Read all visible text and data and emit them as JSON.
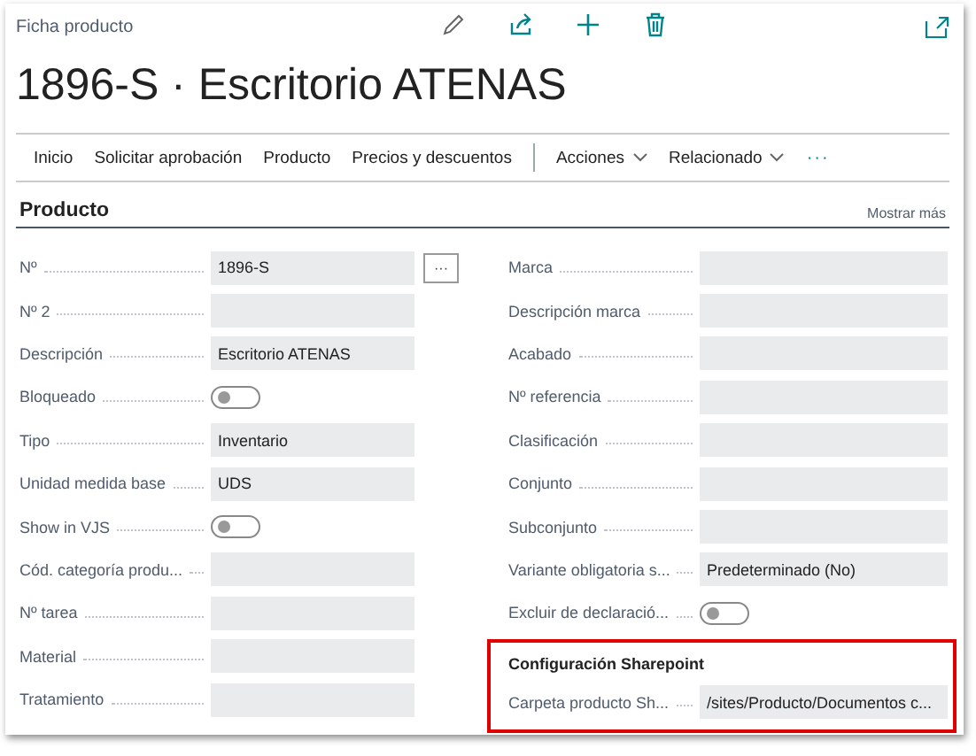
{
  "header": {
    "caption": "Ficha producto",
    "title": "1896-S · Escritorio ATENAS"
  },
  "actions": [
    {
      "label": "Inicio",
      "kind": "plain"
    },
    {
      "label": "Solicitar aprobación",
      "kind": "plain"
    },
    {
      "label": "Producto",
      "kind": "plain"
    },
    {
      "label": "Precios y descuentos",
      "kind": "plain"
    },
    {
      "label": "Acciones",
      "kind": "menu"
    },
    {
      "label": "Relacionado",
      "kind": "menu"
    },
    {
      "label": "···",
      "kind": "more"
    }
  ],
  "section": {
    "title": "Producto",
    "link": "Mostrar más"
  },
  "left_fields": [
    {
      "label": "Nº",
      "kind": "text",
      "value": "1896-S",
      "lookup_button": "···"
    },
    {
      "label": "Nº 2",
      "kind": "text"
    },
    {
      "label": "Descripción",
      "kind": "text",
      "value": "Escritorio ATENAS"
    },
    {
      "label": "Bloqueado",
      "kind": "toggle",
      "on": false
    },
    {
      "label": "Tipo",
      "kind": "text",
      "value": "Inventario"
    },
    {
      "label": "Unidad medida base",
      "kind": "text",
      "value": "UDS"
    },
    {
      "label": "Show in VJS",
      "kind": "toggle",
      "on": false
    },
    {
      "label": "Cód. categoría produ...",
      "kind": "text"
    },
    {
      "label": "Nº tarea",
      "kind": "text"
    },
    {
      "label": "Material",
      "kind": "text"
    },
    {
      "label": "Tratamiento",
      "kind": "text"
    }
  ],
  "right_fields": [
    {
      "label": "Marca",
      "kind": "text"
    },
    {
      "label": "Descripción marca",
      "kind": "text"
    },
    {
      "label": "Acabado",
      "kind": "text"
    },
    {
      "label": "Nº referencia",
      "kind": "text"
    },
    {
      "label": "Clasificación",
      "kind": "text"
    },
    {
      "label": "Conjunto",
      "kind": "text"
    },
    {
      "label": "Subconjunto",
      "kind": "text"
    },
    {
      "label": "Variante obligatoria s...",
      "kind": "text",
      "value": "Predeterminado (No)"
    },
    {
      "label": "Excluir de declaració...",
      "kind": "toggle",
      "on": false
    }
  ],
  "sharepoint_group": {
    "title": "Configuración Sharepoint",
    "highlighted": true,
    "fields": [
      {
        "label": "Carpeta producto Sh...",
        "kind": "text",
        "value": "/sites/Producto/Documentos c..."
      }
    ]
  }
}
